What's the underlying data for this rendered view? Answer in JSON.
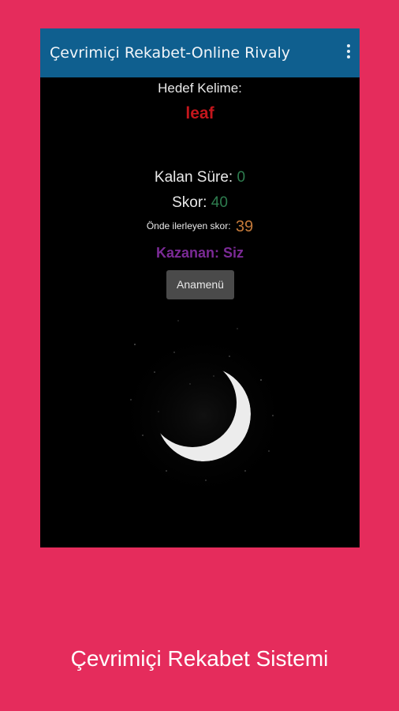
{
  "appbar": {
    "title": "Çevrimiçi Rekabet-Online Rivaly",
    "menu_icon": "overflow-menu-icon"
  },
  "game": {
    "target_label": "Hedef Kelime:",
    "target_word": "leaf",
    "time_label": "Kalan Süre:",
    "time_value": "0",
    "score_label": "Skor:",
    "score_value": "40",
    "leader_label": "Önde ilerleyen skor:",
    "leader_value": "39",
    "winner_text": "Kazanan: Siz",
    "main_menu_button": "Anamenü"
  },
  "caption": "Çevrimiçi Rekabet Sistemi",
  "colors": {
    "background": "#e52c5c",
    "appbar": "#0f5f8f",
    "target_word": "#c4161c",
    "green_value": "#2e7d4f",
    "leader_value": "#c47a3a",
    "winner": "#7b2a96"
  }
}
